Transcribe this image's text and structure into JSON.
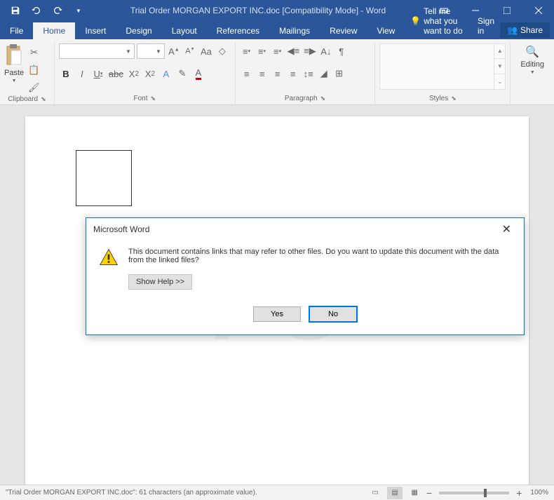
{
  "titlebar": {
    "title": "Trial Order MORGAN EXPORT INC.doc [Compatibility Mode] - Word"
  },
  "tabs": {
    "file": "File",
    "home": "Home",
    "insert": "Insert",
    "design": "Design",
    "layout": "Layout",
    "references": "References",
    "mailings": "Mailings",
    "review": "Review",
    "view": "View",
    "tellme": "Tell me what you want to do",
    "signin": "Sign in",
    "share": "Share"
  },
  "ribbon": {
    "paste": "Paste",
    "clipboard": "Clipboard",
    "font": "Font",
    "paragraph": "Paragraph",
    "styles": "Styles",
    "editing": "Editing",
    "fontname_placeholder": "",
    "fontsize_placeholder": ""
  },
  "dialog": {
    "title": "Microsoft Word",
    "message": "This document contains links that may refer to other files. Do you want to update this document with the data from the linked files?",
    "show_help": "Show Help >>",
    "yes": "Yes",
    "no": "No"
  },
  "statusbar": {
    "text": "\"Trial Order MORGAN EXPORT INC.doc\": 61 characters (an approximate value).",
    "zoom": "100%"
  }
}
